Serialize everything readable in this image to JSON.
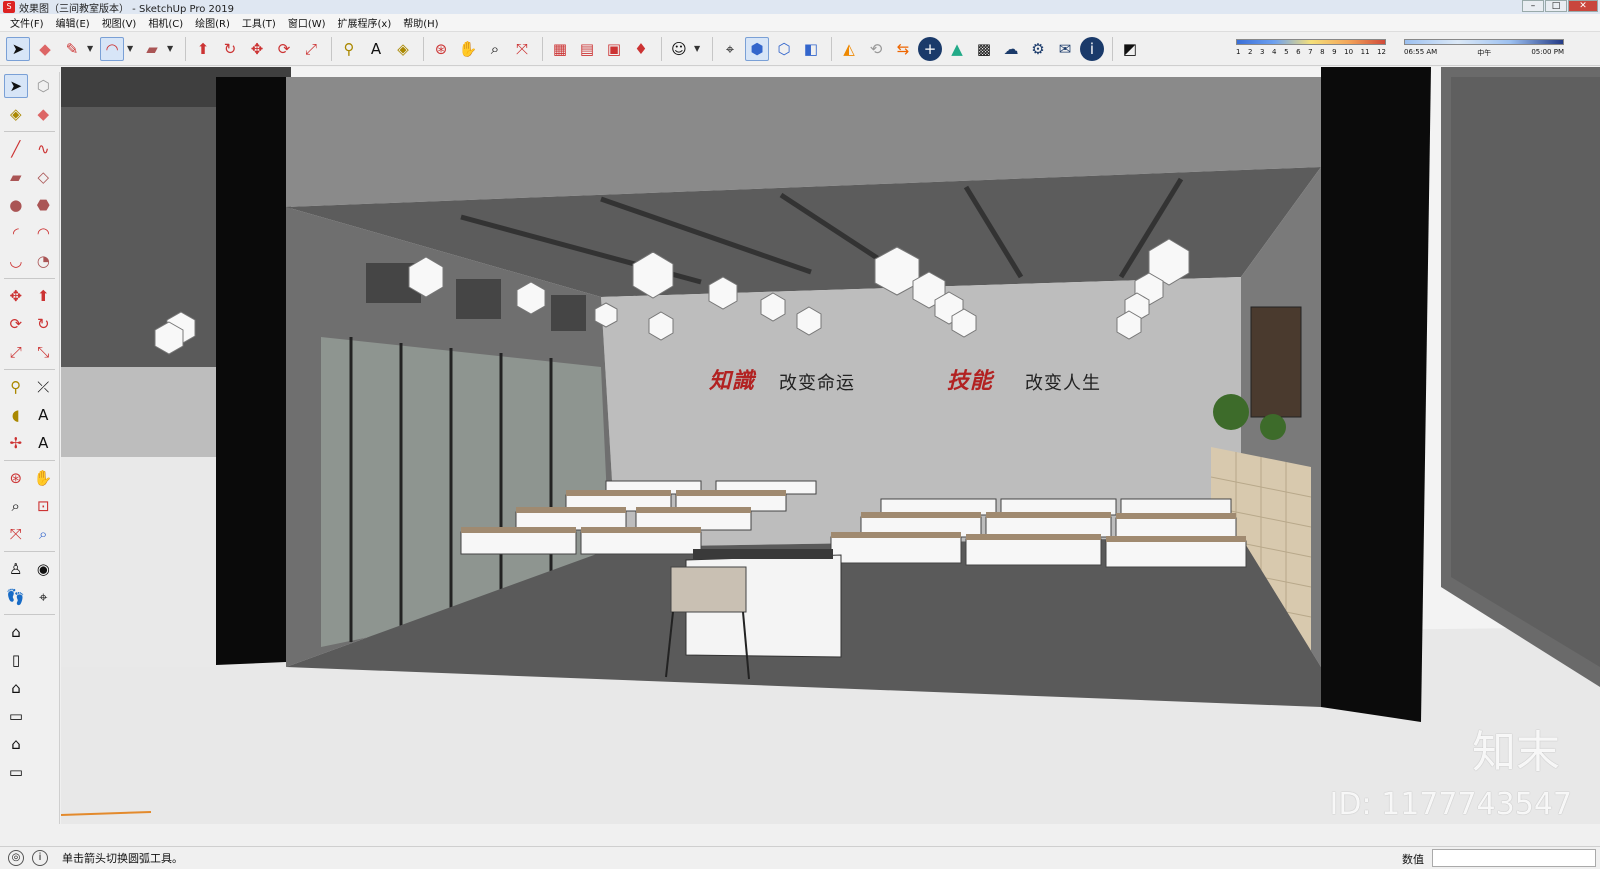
{
  "window": {
    "title": "效果图（三间教室版本） - SketchUp Pro 2019",
    "minimize": "–",
    "maximize": "□",
    "close": "✕"
  },
  "menu": [
    "文件(F)",
    "编辑(E)",
    "视图(V)",
    "相机(C)",
    "绘图(R)",
    "工具(T)",
    "窗口(W)",
    "扩展程序(x)",
    "帮助(H)"
  ],
  "toolbar": {
    "groups": [
      [
        "select-icon",
        "eraser-icon",
        "pencil-icon",
        "arc-icon",
        "rectangle-icon"
      ],
      [
        "push-pull-icon",
        "follow-me-icon",
        "move-icon",
        "rotate-icon",
        "scale-icon"
      ],
      [
        "tape-measure-icon",
        "text-icon",
        "paint-bucket-icon"
      ],
      [
        "orbit-icon",
        "pan-icon",
        "zoom-icon",
        "zoom-extents-icon"
      ],
      [
        "warehouse-icon",
        "extension-warehouse-icon",
        "layout-icon",
        "ruby-icon"
      ],
      [
        "profile-icon"
      ],
      [
        "position-camera-icon",
        "iso-view-icon",
        "top-view-icon",
        "front-view-icon"
      ],
      [
        "sandbox-icon",
        "refresh-icon",
        "export-icon",
        "add-icon",
        "upload-icon",
        "texture-icon",
        "cloud-icon",
        "settings-icon",
        "mail-icon",
        "info-icon"
      ],
      [
        "shadow-toggle-icon"
      ]
    ]
  },
  "shadow": {
    "months": [
      "1",
      "2",
      "3",
      "4",
      "5",
      "6",
      "7",
      "8",
      "9",
      "10",
      "11",
      "12"
    ],
    "time_start": "06:55 AM",
    "time_mid": "中午",
    "time_end": "05:00 PM"
  },
  "scene": {
    "slogan_left_red": "知識",
    "slogan_left": "改变命运",
    "slogan_right_red": "技能",
    "slogan_right": "改变人生"
  },
  "watermark": {
    "logo": "知末",
    "id": "ID: 1177743547"
  },
  "status": {
    "hint": "单击箭头切换圆弧工具。",
    "measure_label": "数值",
    "measure_value": ""
  }
}
